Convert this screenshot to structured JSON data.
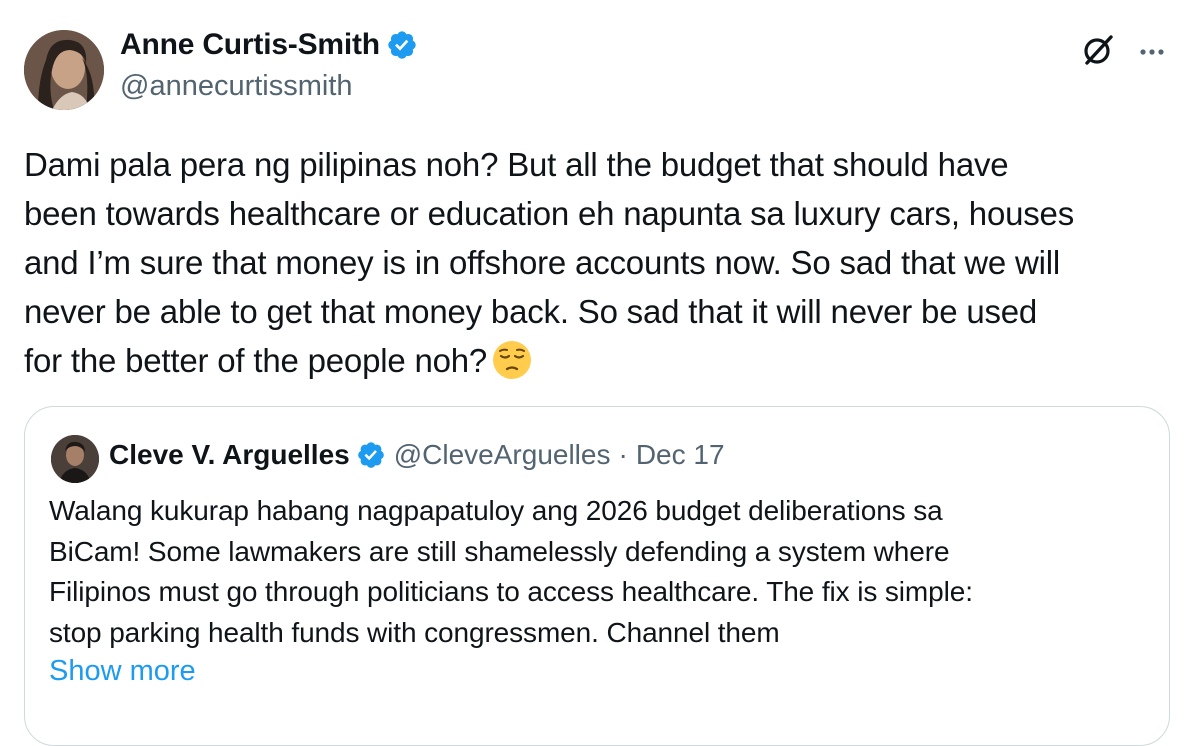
{
  "author": {
    "display_name": "Anne Curtis-Smith",
    "handle": "@annecurtissmith"
  },
  "icons": {
    "verified": "verified-badge-icon",
    "grok": "grok-icon",
    "more": "more-options-icon",
    "emoji": "pensive-face-emoji"
  },
  "colors": {
    "verified_blue": "#1d9bf0",
    "link_blue": "#1d9bf0",
    "secondary_text": "#536471",
    "border": "#cfd9de"
  },
  "tweet": {
    "text": "Dami pala pera ng pilipinas noh? But all the budget that should have\nbeen towards healthcare or education eh napunta sa luxury cars, houses\nand I’m sure that money is in offshore accounts now. So sad that we will\nnever be able to get that money back. So sad that it will never be used\nfor the better of the people noh?"
  },
  "quoted_tweet": {
    "display_name": "Cleve V. Arguelles",
    "handle": "@CleveArguelles",
    "separator": "·",
    "date": "Dec 17",
    "text": "Walang kukurap habang nagpapatuloy ang 2026 budget deliberations sa\nBiCam! Some lawmakers are still shamelessly defending a system where\nFilipinos must go through politicians to access healthcare. The fix is simple:\nstop parking health funds with congressmen. Channel them",
    "show_more_label": "Show more"
  }
}
